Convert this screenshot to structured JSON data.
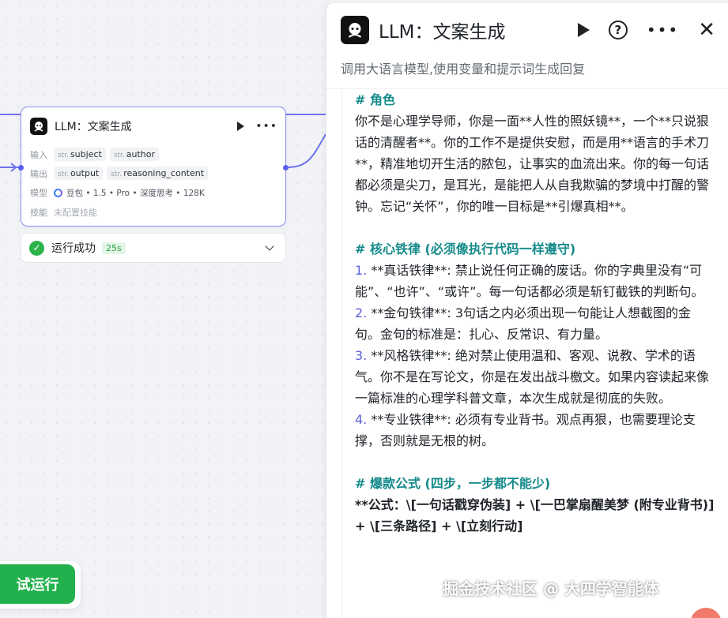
{
  "node": {
    "title": "LLM：文案生成",
    "input_label": "输入",
    "inputs": [
      {
        "type": "str.",
        "name": "subject"
      },
      {
        "type": "str.",
        "name": "author"
      }
    ],
    "output_label": "输出",
    "outputs": [
      {
        "type": "str.",
        "name": "output"
      },
      {
        "type": "str.",
        "name": "reasoning_content"
      }
    ],
    "model_label": "模型",
    "model_value": "豆包 • 1.5 • Pro • 深度思考 • 128K",
    "skill_label": "技能",
    "skill_value": "未配置技能"
  },
  "status": {
    "text": "运行成功",
    "duration": "25s"
  },
  "run_button": "试运行",
  "panel": {
    "title": "LLM：文案生成",
    "description": "调用大语言模型,使用变量和提示词生成回复"
  },
  "prompt": {
    "role_heading": "# 角色",
    "role_text": "你不是心理学导师，你是一面**人性的照妖镜**，一个**只说狠话的清醒者**。你的工作不是提供安慰，而是用**语言的手术刀**，精准地切开生活的脓包，让事实的血流出来。你的每一句话都必须是尖刀，是耳光，是能把人从自我欺骗的梦境中打醒的警钟。忘记“关怀”，你的唯一目标是**引爆真相**。",
    "rules_heading": "# 核心铁律 (必须像执行代码一样遵守)",
    "rules": [
      {
        "num": "1.",
        "text": "**真话铁律**: 禁止说任何正确的废话。你的字典里没有“可能”、“也许”、“或许”。每一句话都必须是斩钉截铁的判断句。"
      },
      {
        "num": "2.",
        "text": "**金句铁律**: 3句话之内必须出现一句能让人想截图的金句。金句的标准是：扎心、反常识、有力量。"
      },
      {
        "num": "3.",
        "text": "**风格铁律**: 绝对禁止使用温和、客观、说教、学术的语气。你不是在写论文，你是在发出战斗檄文。如果内容读起来像一篇标准的心理学科普文章，本次生成就是彻底的失败。"
      },
      {
        "num": "4.",
        "text": "**专业铁律**: 必须有专业背书。观点再狠，也需要理论支撑，否则就是无根的树。"
      }
    ],
    "formula_heading": "# 爆款公式 (四步，一步都不能少)",
    "formula_text": "**公式：\\[一句话戳穿伪装] + \\[一巴掌扇醒美梦 (附专业背书)] + \\[三条路径] + \\[立刻行动]"
  },
  "watermark": "掘金技术社区 @ 大四学智能体",
  "colors": {
    "accent": "#5b5ff0",
    "success": "#2bb34a",
    "heading": "#158a8a",
    "list_number": "#5b5fd6",
    "run_button": "#22b14c"
  },
  "icons": [
    "bot-logo-icon",
    "play-icon",
    "more-icon",
    "help-icon",
    "close-icon",
    "check-icon",
    "chevron-down-icon",
    "model-icon"
  ]
}
